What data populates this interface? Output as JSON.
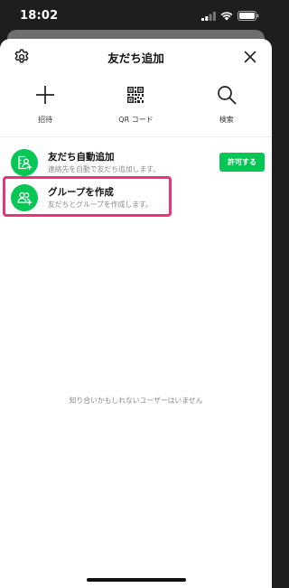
{
  "status_bar": {
    "time": "18:02"
  },
  "header": {
    "title": "友だち追加"
  },
  "shortcuts": [
    {
      "label": "招待",
      "icon": "plus-icon"
    },
    {
      "label": "QR コード",
      "icon": "qr-code-icon"
    },
    {
      "label": "検索",
      "icon": "search-icon"
    }
  ],
  "rows": [
    {
      "title": "友だち自動追加",
      "subtitle": "連絡先を自動で友だち追加します。",
      "icon": "auto-add-friend-icon",
      "action_label": "許可する"
    },
    {
      "title": "グループを作成",
      "subtitle": "友だちとグループを作成します。",
      "icon": "create-group-icon"
    }
  ],
  "empty_message": "知り合いかもしれないユーザーはいません",
  "colors": {
    "accent": "#06c755",
    "highlight": "#f0307a"
  }
}
